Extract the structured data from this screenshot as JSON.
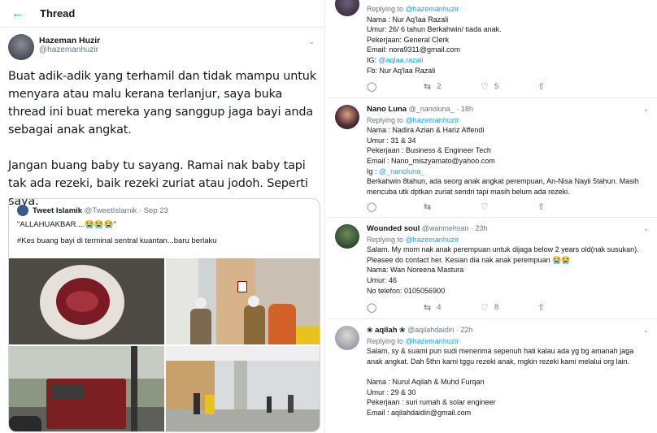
{
  "header": {
    "back_icon": "back-arrow-icon",
    "title": "Thread"
  },
  "main_tweet": {
    "name": "Hazeman Huzir",
    "handle": "@hazemanhuzir",
    "paragraphs": [
      "Buat adik-adik yang terhamil dan tidak mampu untuk menyara atau malu kerana terlanjur, saya buka thread ini buat mereka yang sanggup jaga bayi anda sebagai anak angkat.",
      "Jangan buang baby tu sayang. Ramai nak baby tapi tak ada rezeki, baik rezeki zuriat atau jodoh. Seperti saya."
    ],
    "quote": {
      "name": "Tweet Islamik",
      "handle": "@TweetIslamik",
      "date": "· Sep 23",
      "line1": "\"ALLAHUAKBAR....😭😭😭\"",
      "line2": "#Kes buang bayi di terminal sentral kuantan...baru berlaku"
    }
  },
  "replies": [
    {
      "name": "",
      "handle": "",
      "time": "",
      "replying_label": "Replying to",
      "replying_to": "@hazemanhuzir",
      "lines": [
        "Nama : Nur Aq'laa Razali",
        "Umur: 26/ 6 tahun Berkahwin/ tiada anak.",
        "Pekerjaan: General Clerk",
        "Email: nora9311@gmail.com",
        "IG: ",
        "Fb: Nur Aq'laa Razali"
      ],
      "ig": "@aqlaa.razali",
      "reply_count": "",
      "retweet_count": "2",
      "like_count": "5"
    },
    {
      "name": "Nano Luna",
      "handle": "@_nanoluna_",
      "time": "· 18h",
      "replying_label": "Replying to",
      "replying_to": "@hazemanhuzir",
      "lines": [
        "Nama : Nadira Azian & Hariz Affendi",
        "Umur : 31 & 34",
        "Pekerjaan : Business & Engineer Tech",
        "Email : Nano_miszyamato@yahoo.com",
        "Ig : ",
        "Berkahwin 8tahun, ada seorg anak angkat perempuan, An-Nisa Nayli 5tahun. Masih mencuba utk dptkan zuriat sendri tapi masih belum ada rezeki."
      ],
      "ig": "@_nanoluna_",
      "reply_count": "",
      "retweet_count": "",
      "like_count": ""
    },
    {
      "name": "Wounded soul",
      "handle": "@wanmehsan",
      "time": "· 23h",
      "replying_label": "Replying to",
      "replying_to": "@hazemanhuzir",
      "lines": [
        "Salam. My mom nak anak perempuan untuk dijaga below 2 years old(nak susukan). Pleasee do contact her. Kesian dia nak anak perempuan 😭😭",
        "Nama: Wan Noreena Mastura",
        "Umur: 46",
        "No telefon: 0105056900"
      ],
      "reply_count": "",
      "retweet_count": "4",
      "like_count": "8"
    },
    {
      "name": "aqilah",
      "handle": "@aqilahdaidiri",
      "time": "· 22h",
      "replying_label": "Replying to",
      "replying_to": "@hazemanhuzir",
      "lines": [
        "Salam, sy & suami pun sudi menerima sepenuh hati kalau ada yg bg amanah jaga anak angkat. Dah 5thn kami tggu rezeki anak, mgkin rezeki kami melalui org lain.",
        "",
        "Nama : Nurul Aqilah & Muhd Furqan",
        "Umur : 29 & 30",
        "Pekerjaan : suri rumah & solar engineer",
        "Email : aqilahdaidiri@gmail.com"
      ]
    }
  ]
}
